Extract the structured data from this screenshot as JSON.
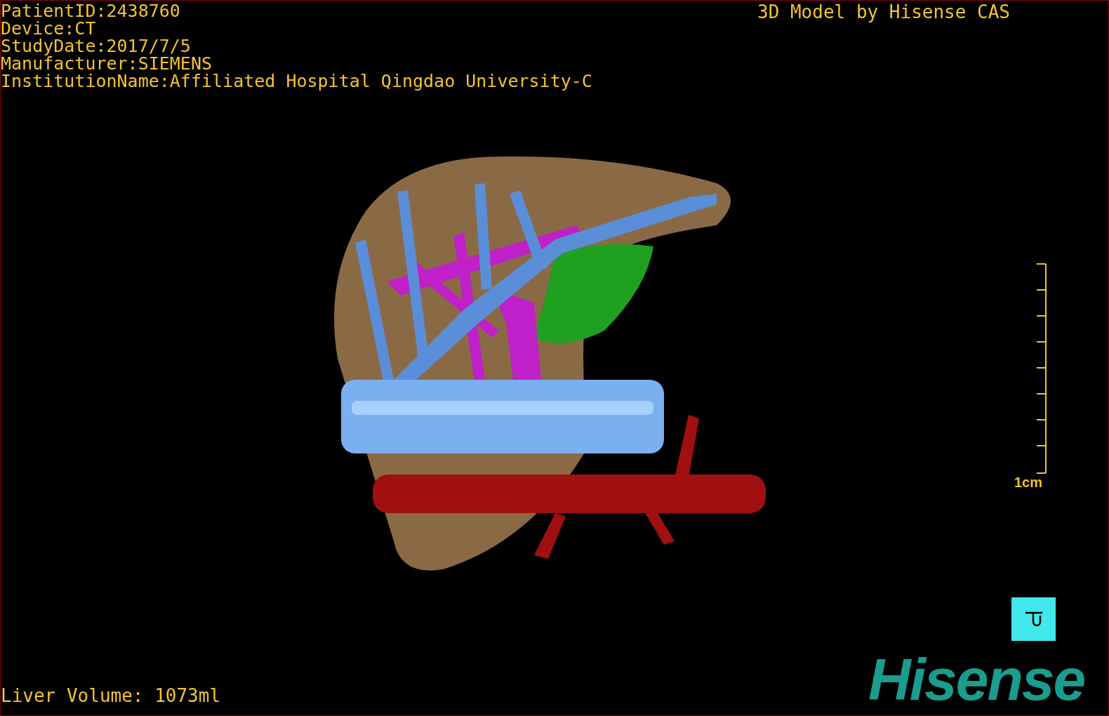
{
  "info_lines": [
    "PatientID:2438760",
    "Device:CT",
    "StudyDate:2017/7/5",
    "Manufacturer:SIEMENS",
    "InstitutionName:Affiliated Hospital Qingdao University-C"
  ],
  "model_credit": "3D Model by Hisense CAS",
  "scale_bar": {
    "label": "1cm"
  },
  "liver_volume": "Liver Volume: 1073ml",
  "logo": "Hisense"
}
